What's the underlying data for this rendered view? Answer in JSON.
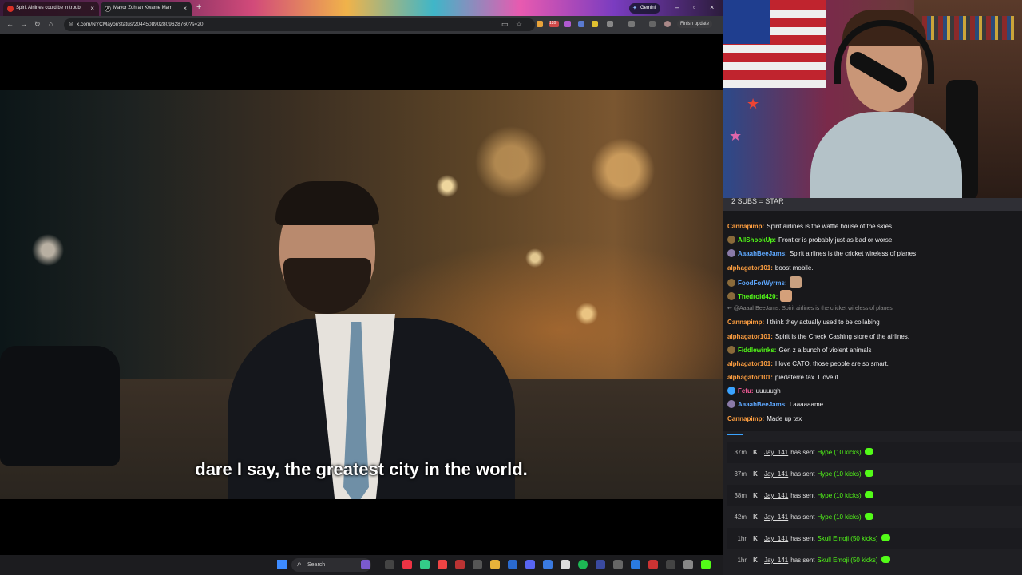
{
  "browser": {
    "tabs": [
      {
        "title": "Spirit Airlines could be in troub"
      },
      {
        "title": "Mayor Zohran Kwame Mam"
      }
    ],
    "gemini_label": "Gemini",
    "url": "x.com/NYCMayor/status/2044508902809628760?s=20",
    "finish_update": "Finish update",
    "extension_badge": "120"
  },
  "video": {
    "caption": "dare I say, the greatest city in the world."
  },
  "taskbar": {
    "search_placeholder": "Search"
  },
  "chat": {
    "banner": "2 SUBS = STAR",
    "messages": [
      {
        "user": "Cannapimp",
        "text": "Spirit airlines is the waffle house of the skies",
        "color": "#ff9f40",
        "badge": null
      },
      {
        "user": "AllShookUp",
        "text": "Frontier is probably just as bad or worse",
        "color": "#53fc18",
        "badge": "#8a6a3a"
      },
      {
        "user": "AaaahBeeJams",
        "text": "Spirit airlines is the cricket wireless of planes",
        "color": "#5ea8ff",
        "badge": "#8a7aa8"
      },
      {
        "user": "alphagator101",
        "text": "boost mobile.",
        "color": "#ff9f40",
        "badge": null
      },
      {
        "user": "FoodForWyrms",
        "text": "",
        "color": "#5ea8ff",
        "badge": "#8a6a3a",
        "emote": "#c9a080"
      },
      {
        "user": "Thedroid420",
        "text": "",
        "color": "#53fc18",
        "badge": "#8a6a3a",
        "emote": "#d4a07a"
      },
      {
        "reply": true,
        "text": "@AaaahBeeJams: Spirit airlines is the cricket wireless of planes"
      },
      {
        "user": "Cannapimp",
        "text": "I think they actually used to be collabing",
        "color": "#ff9f40",
        "badge": null
      },
      {
        "user": "alphagator101",
        "text": "Spirit is the Check Cashing store of the airlines.",
        "color": "#ff9f40",
        "badge": null
      },
      {
        "user": "Fiddlewinks",
        "text": "Gen z a bunch of violent animals",
        "color": "#53fc18",
        "badge": "#8a6a3a"
      },
      {
        "user": "alphagator101",
        "text": "I love CATO. those people are so smart.",
        "color": "#ff9f40",
        "badge": null
      },
      {
        "user": "alphagator101",
        "text": "piedaterre tax. I love it.",
        "color": "#ff9f40",
        "badge": null
      },
      {
        "user": "Fefu",
        "text": "uuuuugh",
        "color": "#ff5e9e",
        "badge": "#3aa3ff"
      },
      {
        "user": "AaaahBeeJams",
        "text": "Laaaaaame",
        "color": "#5ea8ff",
        "badge": "#8a7aa8"
      },
      {
        "user": "Cannapimp",
        "text": "Made up tax",
        "color": "#ff9f40",
        "badge": null
      }
    ]
  },
  "events": [
    {
      "time": "37m",
      "user": "Jay_141",
      "action": "has sent",
      "gift": "Hype (10 kicks)"
    },
    {
      "time": "37m",
      "user": "Jay_141",
      "action": "has sent",
      "gift": "Hype (10 kicks)"
    },
    {
      "time": "38m",
      "user": "Jay_141",
      "action": "has sent",
      "gift": "Hype (10 kicks)"
    },
    {
      "time": "42m",
      "user": "Jay_141",
      "action": "has sent",
      "gift": "Hype (10 kicks)"
    },
    {
      "time": "1hr",
      "user": "Jay_141",
      "action": "has sent",
      "gift": "Skull Emoji (50 kicks)"
    },
    {
      "time": "1hr",
      "user": "Jay_141",
      "action": "has sent",
      "gift": "Skull Emoji (50 kicks)"
    }
  ],
  "colors": {
    "kick_green": "#53fc18",
    "chat_bg": "#18181b",
    "browser_toolbar": "#35363a"
  }
}
